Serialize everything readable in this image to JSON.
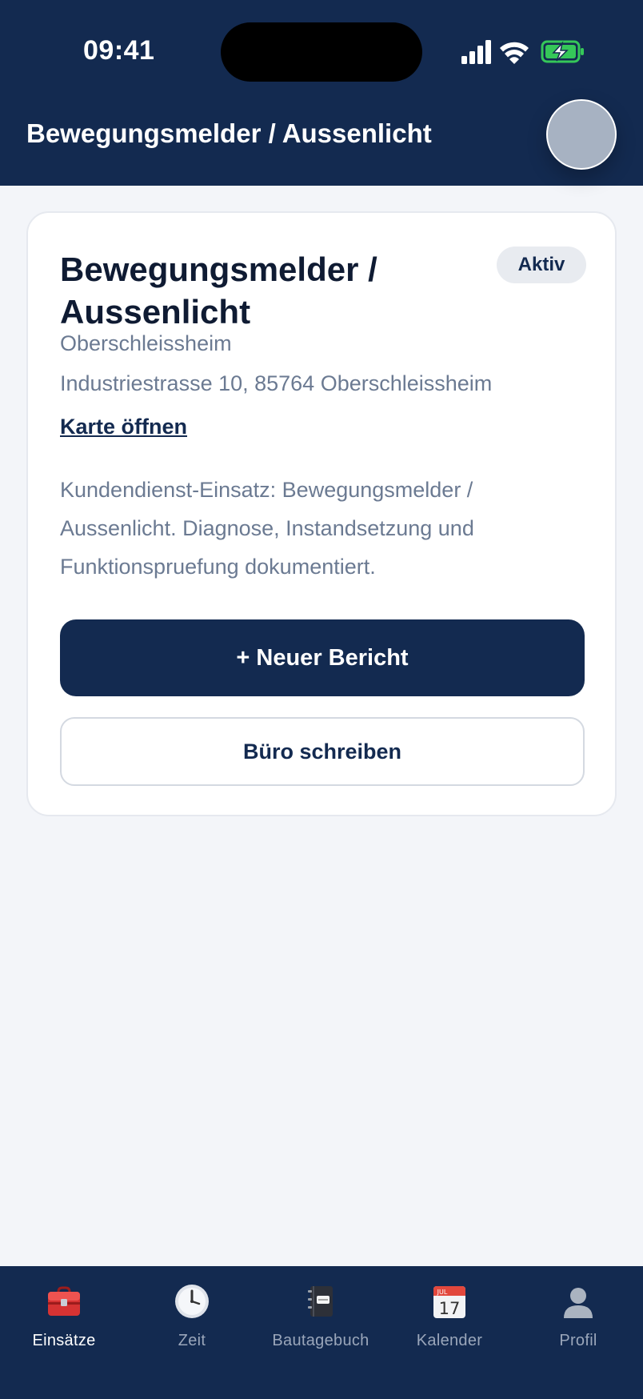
{
  "status_bar": {
    "time": "09:41"
  },
  "header": {
    "title": "Bewegungsmelder / Aussenlicht"
  },
  "job": {
    "title": "Bewegungsmelder / Aussenlicht",
    "status": "Aktiv",
    "location": "Oberschleissheim",
    "address": "Industriestrasse 10, 85764 Oberschleissheim",
    "map_link": "Karte öffnen",
    "description": "Kundendienst-Einsatz: Bewegungsmelder / Aussenlicht. Diagnose, Instandsetzung und Funktionspruefung dokumentiert.",
    "primary_action": "+ Neuer Bericht",
    "secondary_action": "Büro schreiben"
  },
  "tabbar": {
    "items": [
      {
        "label": "Einsätze",
        "icon": "toolbox-icon",
        "active": true
      },
      {
        "label": "Zeit",
        "icon": "clock-icon",
        "active": false
      },
      {
        "label": "Bautagebuch",
        "icon": "notebook-icon",
        "active": false
      },
      {
        "label": "Kalender",
        "icon": "calendar-icon",
        "active": false,
        "icon_text_month": "JUL",
        "icon_text_day": "17"
      },
      {
        "label": "Profil",
        "icon": "person-icon",
        "active": false
      }
    ]
  },
  "colors": {
    "brand_navy": "#132a50",
    "background": "#f3f5f9",
    "muted_text": "#6b7a92",
    "battery_green": "#35c759"
  }
}
